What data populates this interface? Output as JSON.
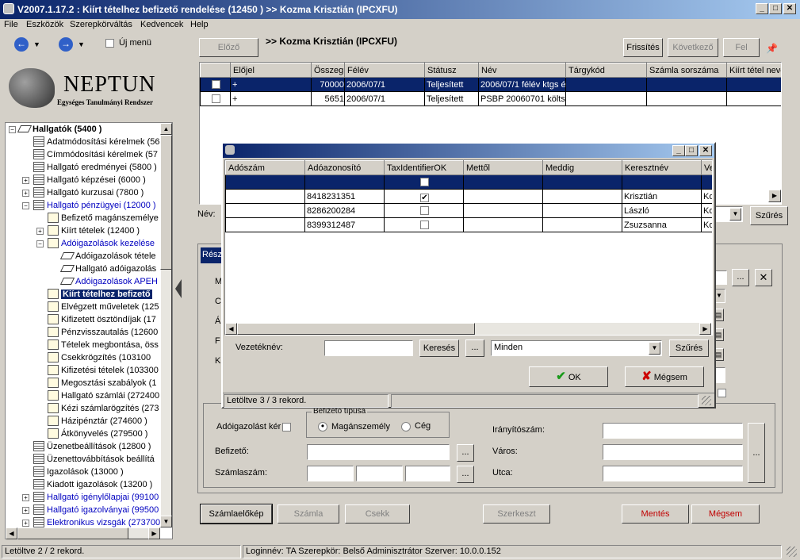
{
  "window": {
    "title": "V2007.1.17.2 : Kiírt tételhez befizető rendelése (12450 )  >> Kozma Krisztián (IPCXFU)"
  },
  "menu": [
    "File",
    "Eszközök",
    "Szerepkörváltás",
    "Kedvencek",
    "Help"
  ],
  "nav": {
    "new_menu_label": "Új menü"
  },
  "logo": {
    "title": "NEPTUN",
    "subtitle": "Egységes Tanulmányi Rendszer"
  },
  "tree": {
    "root": "Hallgatók (5400 )",
    "items": [
      "Adatmódosítási kérelmek (56",
      "Címmódosítási kérelmek (57",
      "Hallgató eredményei (5800 )",
      "Hallgató képzései (6000 )",
      "Hallgató kurzusai (7800 )",
      "Hallgató pénzügyei (12000 )",
      "Befizető magánszemélye",
      "Kiírt tételek (12400 )",
      "Adóigazolások kezelése",
      "Adóigazolások tétele",
      "Hallgató adóigazolás",
      "Adóigazolások APEH",
      "Kiírt tételhez befizető",
      "Elvégzett műveletek (125",
      "Kifizetett ösztöndíjak (17",
      "Pénzvisszautalás (12600",
      "Tételek megbontása, öss",
      "Csekkrögzítés (103100",
      "Kifizetési tételek (103300",
      "Megosztási szabályok (1",
      "Hallgató számlái (272400",
      "Kézi számlarögzítés (273",
      "Házipénztár (274600 )",
      "Átkönyvelés (279500 )",
      "Üzenetbeállítások (12800 )",
      "Üzenettovábbítások beállítá",
      "Igazolások (13000 )",
      "Kiadott igazolások (13200 )",
      "Hallgató igénylőlapjai (99100",
      "Hallgató igazolványai (99500",
      "Elektronikus vizsgák (273700"
    ]
  },
  "toolbar": {
    "prev": "Előző",
    "person": ">> Kozma Krisztián (IPCXFU)",
    "refresh": "Frissítés",
    "next": "Következő",
    "up": "Fel"
  },
  "main_grid": {
    "headers": [
      "",
      "Előjel",
      "Összeg",
      "Félév",
      "Státusz",
      "Név",
      "Tárgykód",
      "Számla sorszáma",
      "Kiírt tétel neve"
    ],
    "rows": [
      [
        "",
        "+",
        "70000",
        "2006/07/1",
        "Teljesített",
        "2006/07/1 félév ktgs é",
        "",
        "",
        ""
      ],
      [
        "",
        "+",
        "5651",
        "2006/07/1",
        "Teljesített",
        "PSBP 20060701 költs",
        "",
        "",
        ""
      ]
    ]
  },
  "filter": {
    "name_label": "Név:",
    "filter_btn": "Szűrés"
  },
  "details": {
    "tab_label": "Rész",
    "hidden_labels": [
      "M",
      "C",
      "Á",
      "F",
      "K"
    ],
    "tax_checkbox_label": "Adóigazolást kér",
    "payer_type_title": "Befizető típusa",
    "radio_private": "Magánszemély",
    "radio_company": "Cég",
    "payer_label": "Befizető:",
    "account_label": "Számlaszám:",
    "zip_label": "Irányítószám:",
    "city_label": "Város:",
    "street_label": "Utca:"
  },
  "bottom_buttons": {
    "preview": "Számlaelőkép",
    "invoice": "Számla",
    "cheque": "Csekk",
    "edit": "Szerkeszt",
    "save": "Mentés",
    "cancel": "Mégsem"
  },
  "dialog": {
    "headers": [
      "Adószám",
      "Adóazonosító",
      "TaxIdentifierOK",
      "Mettől",
      "Meddig",
      "Keresztnév",
      "Ve"
    ],
    "rows": [
      [
        "",
        "",
        "",
        "",
        "",
        "",
        ""
      ],
      [
        "",
        "8418231351",
        "✔",
        "",
        "",
        "Krisztián",
        "Ko"
      ],
      [
        "",
        "8286200284",
        "",
        "",
        "",
        "László",
        "Ko"
      ],
      [
        "",
        "8399312487",
        "",
        "",
        "",
        "Zsuzsanna",
        "Ko"
      ]
    ],
    "surname_label": "Vezetéknév:",
    "search_btn": "Keresés",
    "dots": "...",
    "select_value": "Minden",
    "filter_btn": "Szűrés",
    "ok_btn": "OK",
    "cancel_btn": "Mégsem",
    "status": "Letöltve 3 / 3 rekord."
  },
  "statusbar": {
    "left": "Letöltve 2 / 2 rekord.",
    "middle": "Loginnév: TA  Szerepkör: Belső Adminisztrátor  Szerver: 10.0.0.152"
  },
  "colors": {
    "selection": "#0a246a",
    "link": "#0000c0",
    "danger": "#c00000"
  }
}
